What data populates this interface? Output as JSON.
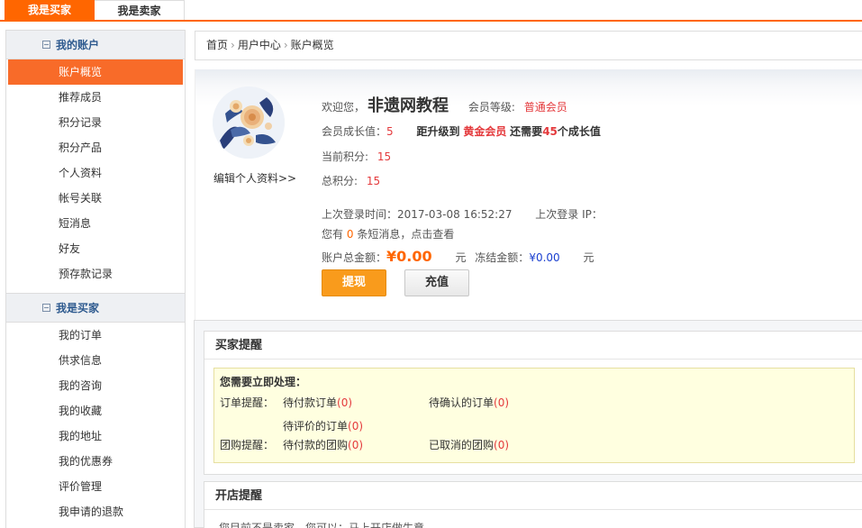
{
  "tabs": {
    "buyer": "我是买家",
    "seller": "我是卖家"
  },
  "sidebar": {
    "account_section": "我的账户",
    "account_items": [
      "账户概览",
      "推荐成员",
      "积分记录",
      "积分产品",
      "个人资料",
      "帐号关联",
      "短消息",
      "好友",
      "预存款记录"
    ],
    "buyer_section": "我是买家",
    "buyer_items": [
      "我的订单",
      "供求信息",
      "我的咨询",
      "我的收藏",
      "我的地址",
      "我的优惠券",
      "评价管理",
      "我申请的退款"
    ]
  },
  "breadcrumb": {
    "home": "首页",
    "center": "用户中心",
    "current": "账户概览"
  },
  "profile": {
    "edit_link": "编辑个人资料>>",
    "welcome": "欢迎您，",
    "username": "非遗网教程",
    "level_label": "会员等级:",
    "level": "普通会员",
    "growth_label": "会员成长值：",
    "growth": "5",
    "upgrade_prefix": "距升级到",
    "upgrade_level": "黄金会员",
    "upgrade_mid": "还需要",
    "upgrade_need": "45",
    "upgrade_suffix": "个成长值",
    "points_label": "当前积分:",
    "points": "15",
    "total_points_label": "总积分:",
    "total_points": "15",
    "last_login_label": "上次登录时间：",
    "last_login": "2017-03-08 16:52:27",
    "last_ip_label": "上次登录 IP：",
    "msg_prefix": "您有",
    "msg_count": "0",
    "msg_suffix": "条短消息，点击查看",
    "balance_label": "账户总金额：",
    "balance": "¥0.00",
    "yuan": "元",
    "frozen_label": "冻结金额：",
    "frozen": "¥0.00",
    "withdraw_button": "提现",
    "recharge_button": "充值"
  },
  "buyer_reminder": {
    "title": "买家提醒",
    "heading": "您需要立即处理：",
    "order_label": "订单提醒：",
    "group_label": "团购提醒：",
    "items": [
      {
        "label": "待付款订单",
        "count": "(0)"
      },
      {
        "label": "待确认的订单",
        "count": "(0)"
      },
      {
        "label": "待评价的订单",
        "count": "(0)"
      },
      {
        "label": "待付款的团购",
        "count": "(0)"
      },
      {
        "label": "已取消的团购",
        "count": "(0)"
      }
    ]
  },
  "shop_reminder": {
    "title": "开店提醒",
    "text": "您目前不是卖家，您可以：马上开店做生意"
  }
}
